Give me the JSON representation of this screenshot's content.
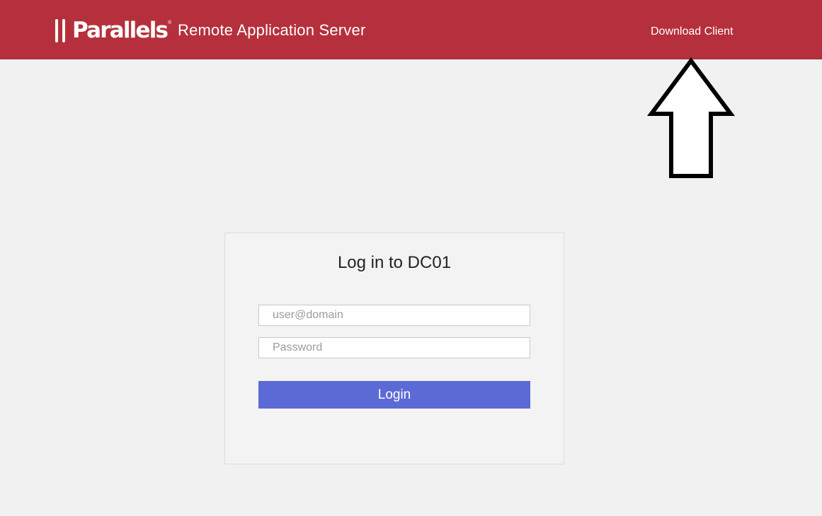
{
  "header": {
    "brand": "Parallels",
    "brand_mark": "®",
    "app_title": "Remote Application Server",
    "download_label": "Download Client",
    "background_color": "#b5303c"
  },
  "annotation": {
    "icon": "up-arrow-icon"
  },
  "login": {
    "title": "Log in to DC01",
    "username_placeholder": "user@domain",
    "username_value": "",
    "password_placeholder": "Password",
    "password_value": "",
    "submit_label": "Login",
    "button_color": "#5c6ad6"
  }
}
